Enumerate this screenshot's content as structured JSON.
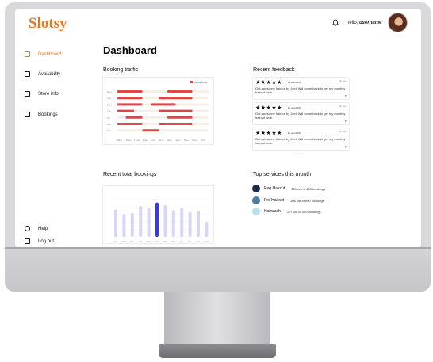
{
  "brand": {
    "logo": "Slotsy",
    "accent": "#e8761e"
  },
  "header": {
    "greeting": "hello, ",
    "username": "username",
    "bell_icon": "bell-icon"
  },
  "sidebar": {
    "items": [
      {
        "label": "Dashboard",
        "icon": "grid-icon",
        "active": true
      },
      {
        "label": "Availability",
        "icon": "calendar-icon",
        "active": false
      },
      {
        "label": "Store info",
        "icon": "store-icon",
        "active": false
      },
      {
        "label": "Bookings",
        "icon": "document-icon",
        "active": false
      }
    ],
    "help": "Help",
    "logout": "Log out"
  },
  "main": {
    "title": "Dashboard",
    "traffic_title": "Booking traffic",
    "feedback_title": "Recent feedback",
    "bookings_title": "Recent total bookings",
    "services_title": "Top services this month"
  },
  "traffic": {
    "legend": "12 bookings",
    "days": [
      "Mon",
      "Tue",
      "Wed",
      "Thu",
      "Fri",
      "Sat",
      "Sun"
    ],
    "times": [
      "9am",
      "10am",
      "11am",
      "12pm",
      "1pm",
      "2pm",
      "3pm",
      "4pm",
      "5pm",
      "6pm",
      "7pm"
    ],
    "bar_color": "#e04646"
  },
  "feedback": [
    {
      "stars": "★★★★★",
      "user": "by user3291",
      "time": "2h ago",
      "text": "Got awesome haircut by Joel. Will come back to get my monthly haircut here."
    },
    {
      "stars": "★★★★★",
      "user": "by user3291",
      "time": "2h ago",
      "text": "Got awesome haircut by Joel. Will come back to get my monthly haircut here."
    },
    {
      "stars": "★★★★★",
      "user": "by user3291",
      "time": "2h ago",
      "text": "Got awesome haircut by Joel. Will come back to get my monthly haircut here."
    }
  ],
  "feedback_more": "view more",
  "chart_data": {
    "type": "bar",
    "categories": [
      "OCT",
      "NOV",
      "DEC",
      "JAN",
      "FEB",
      "MAR",
      "APR",
      "MAY",
      "JUN",
      "JUL",
      "AUG",
      "SEP"
    ],
    "values": [
      80,
      66,
      70,
      90,
      84,
      100,
      92,
      78,
      84,
      72,
      76,
      44
    ],
    "highlight_index": 5,
    "ylim": [
      0,
      120
    ],
    "bar_color": "#d7d7f5",
    "highlight_color": "#3b3bd6"
  },
  "services": [
    {
      "name": "Reg Haircut",
      "count": "200 out of 400 bookings",
      "color": "#1c2b4a"
    },
    {
      "name": "Pro Haircut",
      "count": "108 out of 400 bookings",
      "color": "#4a7ca1"
    },
    {
      "name": "Hairwash",
      "count": "107 out of 400 bookings",
      "color": "#b7e2ea"
    }
  ]
}
